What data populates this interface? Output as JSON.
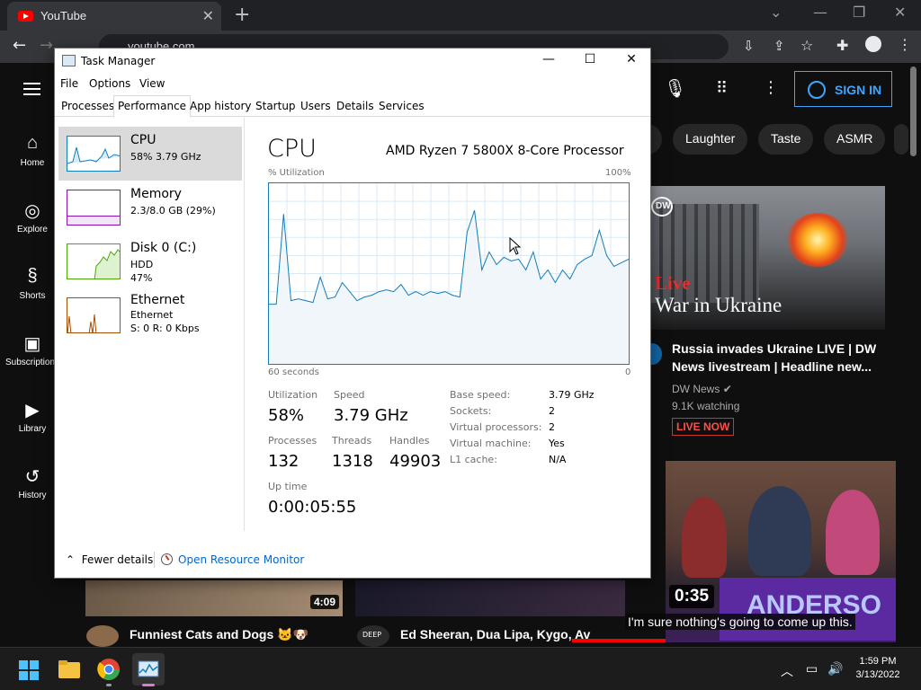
{
  "browser": {
    "tab_title": "YouTube",
    "address": "youtube.com"
  },
  "youtube": {
    "sign_in": "SIGN IN",
    "sidebar": [
      {
        "label": "Home"
      },
      {
        "label": "Explore"
      },
      {
        "label": "Shorts"
      },
      {
        "label": "Subscriptions"
      },
      {
        "label": "Library"
      },
      {
        "label": "History"
      }
    ],
    "chips": [
      "Laughter",
      "Taste",
      "ASMR"
    ],
    "video1": {
      "thumb_live": "Live",
      "thumb_text": "War in Ukraine",
      "thumb_logo": "DW",
      "title_line1": "Russia invades Ukraine LIVE | DW",
      "title_line2": "News livestream | Headline new...",
      "channel": "DW News",
      "watching": "9.1K watching",
      "badge": "LIVE NOW"
    },
    "video2": {
      "duration": "0:35",
      "banner": "ANDERSO"
    },
    "row2": [
      {
        "title": "Funniest Cats and Dogs 🐱🐶",
        "duration": "4:09"
      },
      {
        "title": "Ed Sheeran, Dua Lipa, Kygo, Av",
        "avatar_text": "DEEP"
      }
    ],
    "caption": "I'm sure nothing's going to come up this."
  },
  "task_manager": {
    "title": "Task Manager",
    "menu": [
      "File",
      "Options",
      "View"
    ],
    "tabs": [
      "Processes",
      "Performance",
      "App history",
      "Startup",
      "Users",
      "Details",
      "Services"
    ],
    "active_tab": "Performance",
    "resources": [
      {
        "name": "CPU",
        "sub1": "58%  3.79 GHz",
        "color": "#117dbb"
      },
      {
        "name": "Memory",
        "sub1": "2.3/8.0 GB (29%)",
        "color": "#8b12ae"
      },
      {
        "name": "Disk 0 (C:)",
        "sub1": "HDD",
        "sub2": "47%",
        "color": "#4da60c"
      },
      {
        "name": "Ethernet",
        "sub1": "Ethernet",
        "sub2": "S: 0  R: 0 Kbps",
        "color": "#a74f01"
      }
    ],
    "panel": {
      "heading": "CPU",
      "model": "AMD Ryzen 7 5800X 8-Core Processor",
      "y_label": "% Utilization",
      "y_max_label": "100%",
      "x_label": "60 seconds",
      "x_min_label": "0"
    },
    "stats": {
      "utilization_label": "Utilization",
      "utilization": "58%",
      "speed_label": "Speed",
      "speed": "3.79 GHz",
      "processes_label": "Processes",
      "processes": "132",
      "threads_label": "Threads",
      "threads": "1318",
      "handles_label": "Handles",
      "handles": "49903",
      "uptime_label": "Up time",
      "uptime": "0:00:05:55"
    },
    "details": [
      {
        "k": "Base speed:",
        "v": "3.79 GHz"
      },
      {
        "k": "Sockets:",
        "v": "2"
      },
      {
        "k": "Virtual processors:",
        "v": "2"
      },
      {
        "k": "Virtual machine:",
        "v": "Yes"
      },
      {
        "k": "L1 cache:",
        "v": "N/A"
      }
    ],
    "footer": {
      "fewer_details": "Fewer details",
      "resource_monitor": "Open Resource Monitor"
    }
  },
  "chart_data": {
    "type": "area",
    "ylim": [
      0,
      100
    ],
    "xlim": [
      60,
      0
    ],
    "values": [
      33,
      33,
      83,
      35,
      36,
      35,
      34,
      48,
      36,
      37,
      45,
      40,
      35,
      37,
      38,
      40,
      41,
      40,
      44,
      38,
      40,
      38,
      40,
      39,
      40,
      38,
      37,
      73,
      85,
      52,
      62,
      55,
      59,
      57,
      58,
      52,
      62,
      47,
      52,
      45,
      52,
      47,
      55,
      58,
      60,
      74,
      60,
      54,
      56,
      58
    ]
  },
  "taskbar": {
    "time": "1:59 PM",
    "date": "3/13/2022"
  }
}
